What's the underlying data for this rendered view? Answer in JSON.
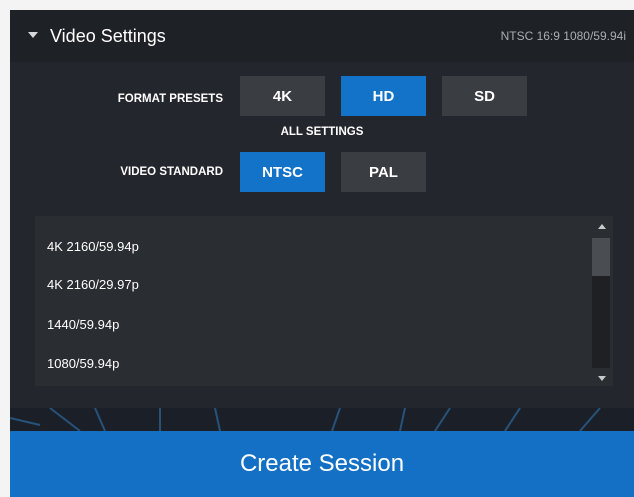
{
  "header": {
    "title": "Video Settings",
    "format_summary": "NTSC 16:9 1080/59.94i",
    "collapse_icon": "caret-down-icon"
  },
  "format_presets": {
    "label": "FORMAT PRESETS",
    "options": [
      "4K",
      "HD",
      "SD"
    ],
    "selected": "HD"
  },
  "all_settings_label": "ALL SETTINGS",
  "video_standard": {
    "label": "VIDEO STANDARD",
    "options": [
      "NTSC",
      "PAL"
    ],
    "selected": "NTSC"
  },
  "format_list": {
    "items": [
      "4K 2160/59.94p",
      "4K 2160/29.97p",
      "1440/59.94p",
      "1080/59.94p"
    ],
    "scroll_up_icon": "arrow-up-icon",
    "scroll_down_icon": "arrow-down-icon"
  },
  "create_button": {
    "label": "Create Session"
  },
  "colors": {
    "accent": "#1273c9",
    "panel": "#23272d",
    "button": "#3a3d42"
  }
}
